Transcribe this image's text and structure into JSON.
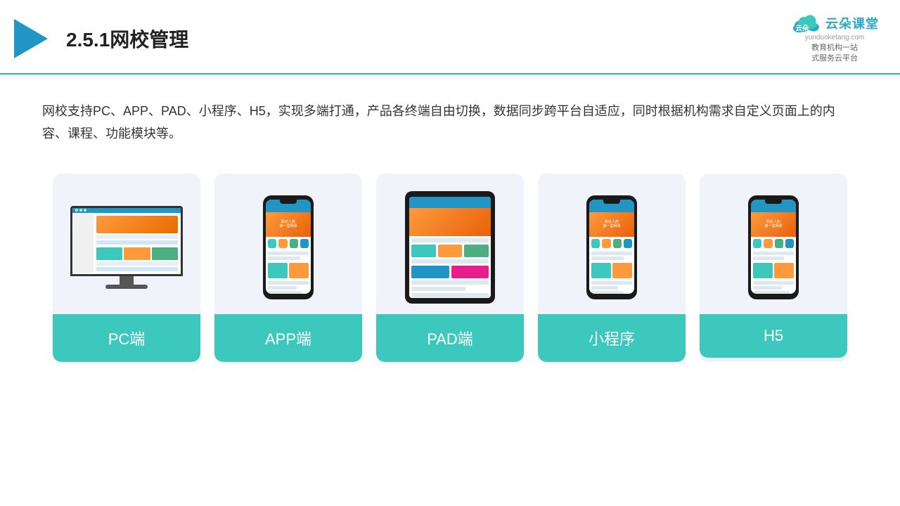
{
  "header": {
    "title": "2.5.1网校管理",
    "brand_name": "云朵课堂",
    "brand_url": "yunduoketang.com",
    "brand_tagline_line1": "教育机构一站",
    "brand_tagline_line2": "式服务云平台"
  },
  "description": {
    "text": "网校支持PC、APP、PAD、小程序、H5，实现多端打通，产品各终端自由切换，数据同步跨平台自适应，同时根据机构需求自定义页面上的内容、课程、功能模块等。"
  },
  "cards": [
    {
      "id": "pc",
      "label": "PC端"
    },
    {
      "id": "app",
      "label": "APP端"
    },
    {
      "id": "pad",
      "label": "PAD端"
    },
    {
      "id": "miniprogram",
      "label": "小程序"
    },
    {
      "id": "h5",
      "label": "H5"
    }
  ],
  "colors": {
    "accent": "#3dc8be",
    "header_line": "#1ab8c8",
    "brand": "#2ea8c8",
    "dark": "#1a1a1a",
    "screen_blue": "#2196c4",
    "orange": "#ff9a3c"
  }
}
